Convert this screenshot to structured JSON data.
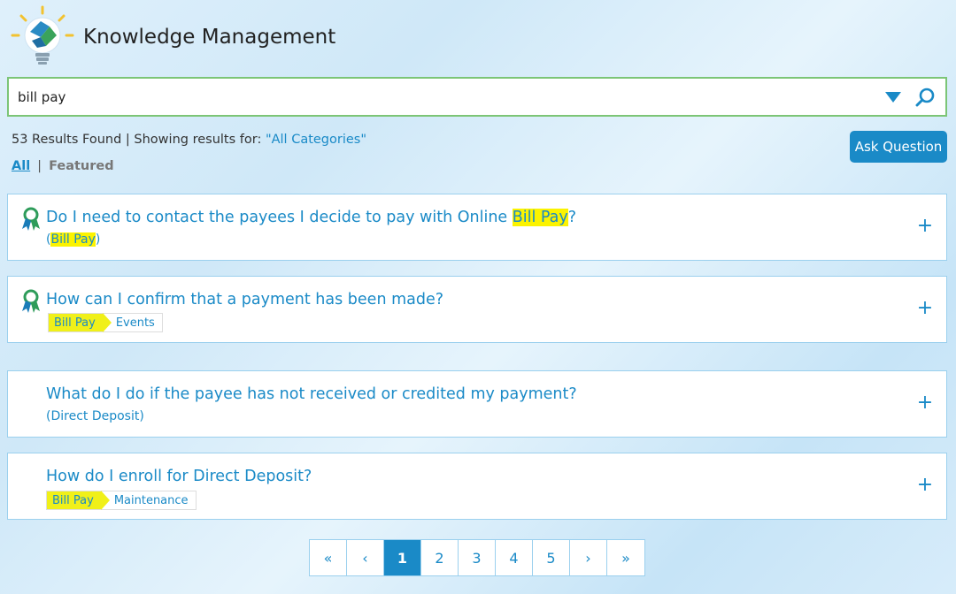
{
  "app": {
    "title": "Knowledge Management"
  },
  "search": {
    "value": "bill pay",
    "placeholder": ""
  },
  "results": {
    "count_text": "53 Results Found",
    "showing_prefix": " | Showing results for: ",
    "category": "\"All Categories\""
  },
  "filters": {
    "all_label": "All",
    "separator": "|",
    "featured_label": "Featured"
  },
  "ask_button": {
    "label": "Ask Question"
  },
  "cards": [
    {
      "title_before": "Do I need to contact the payees I decide to pay with Online ",
      "title_highlight": "Bill Pay",
      "title_after": "?",
      "cat_open": "(",
      "cat_highlight": "Bill Pay",
      "cat_close": ")",
      "featured": true
    },
    {
      "title": "How can I confirm that a payment has been made?",
      "tag_primary": "Bill Pay",
      "tag_secondary": "Events",
      "featured": true
    },
    {
      "title": "What do I do if the payee has not received or credited my payment?",
      "category": "(Direct Deposit)",
      "featured": false
    },
    {
      "title": "How do I enroll for Direct Deposit?",
      "tag_primary": "Bill Pay",
      "tag_secondary": "Maintenance",
      "featured": false
    }
  ],
  "expand_symbol": "+",
  "pagination": {
    "first": "«",
    "prev": "‹",
    "pages": [
      "1",
      "2",
      "3",
      "4",
      "5"
    ],
    "active_page": "1",
    "next": "›",
    "last": "»"
  },
  "colors": {
    "accent": "#1a8ac7",
    "highlight": "#fbf300",
    "search_border": "#7cc576"
  }
}
